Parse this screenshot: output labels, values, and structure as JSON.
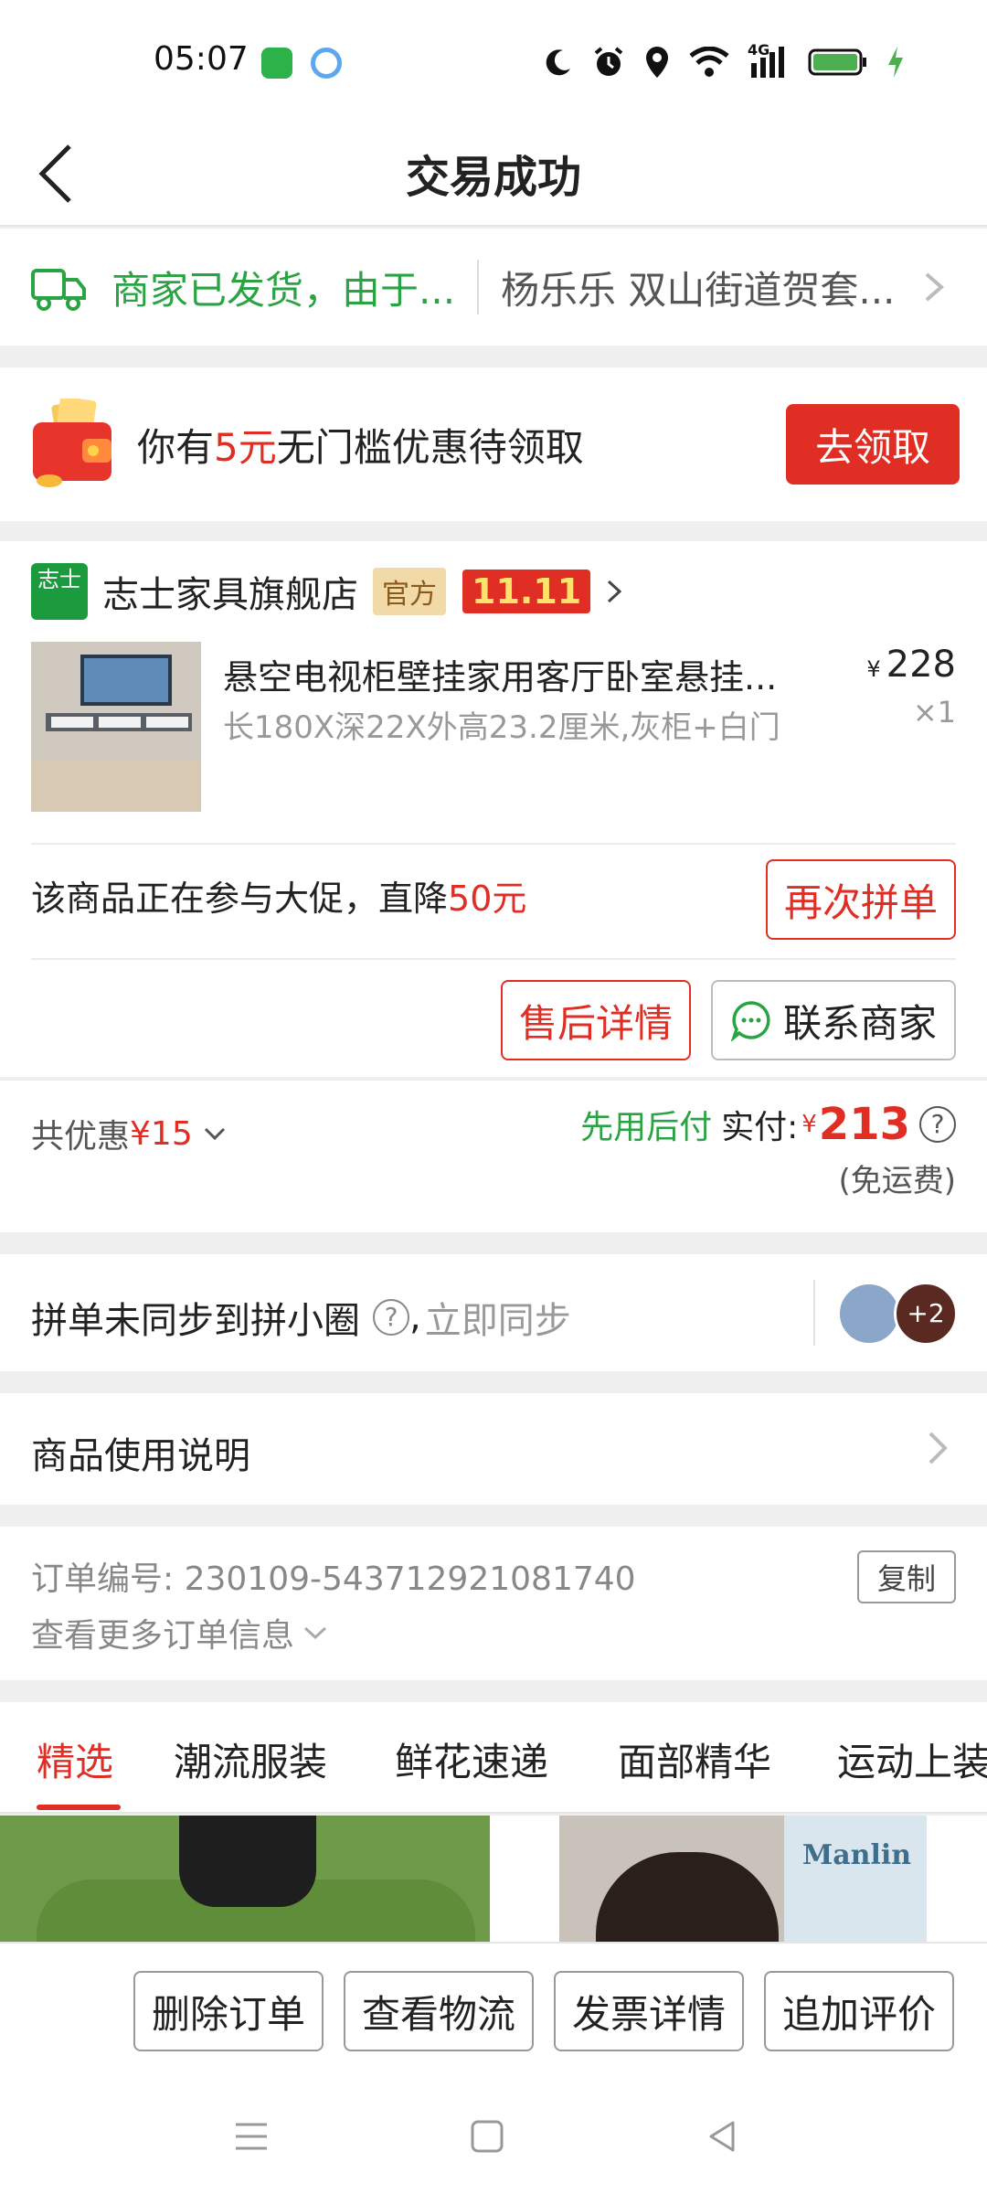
{
  "status_bar": {
    "time": "05:07",
    "network": "4G",
    "icons": [
      "app-green-icon",
      "app-blue-icon",
      "moon-icon",
      "alarm-icon",
      "location-icon",
      "wifi-icon",
      "signal-icon",
      "battery-icon",
      "charging-icon"
    ]
  },
  "header": {
    "title": "交易成功",
    "back_icon": "chevron-left-icon"
  },
  "shipping": {
    "status": "商家已发货，由于...",
    "address": "杨乐乐 双山街道贺套...",
    "status_color": "#2aa343"
  },
  "coupon": {
    "text_prefix": "你有",
    "amount": "5元",
    "text_suffix": "无门槛优惠待领取",
    "button": "去领取"
  },
  "order": {
    "shop": {
      "logo_text": "志士",
      "name": "志士家具旗舰店",
      "official_badge": "官方",
      "promo_badge": "11.11"
    },
    "product": {
      "name": "悬空电视柜壁挂家用客厅卧室悬挂...",
      "spec": "长180X深22X外高23.2厘米,灰柜+白门",
      "currency": "¥",
      "price": "228",
      "quantity": "×1"
    },
    "promo_text": "该商品正在参与大促，直降",
    "promo_amount": "50元",
    "reorder_button": "再次拼单",
    "aftersale_button": "售后详情",
    "contact_button": "联系商家"
  },
  "payment": {
    "discount_label": "共优惠",
    "discount_amount": "¥15",
    "pay_later": "先用后付",
    "paid_label": "实付:",
    "currency": "¥",
    "paid_amount": "213",
    "help": "?",
    "shipping_note": "(免运费)"
  },
  "sync": {
    "label": "拼单未同步到拼小圈",
    "help": "?",
    "separator": ",",
    "action": "立即同步",
    "extra_count": "+2"
  },
  "usage": {
    "label": "商品使用说明"
  },
  "order_info": {
    "number_label": "订单编号:",
    "number": "230109-543712921081740",
    "copy_button": "复制",
    "more": "查看更多订单信息"
  },
  "categories": [
    "精选",
    "潮流服装",
    "鲜花速递",
    "面部精华",
    "运动上装"
  ],
  "feed": {
    "brand_text": "Manlin"
  },
  "actions": [
    "删除订单",
    "查看物流",
    "发票详情",
    "追加评价"
  ],
  "colors": {
    "accent_red": "#e02e24",
    "green": "#2aa343"
  }
}
